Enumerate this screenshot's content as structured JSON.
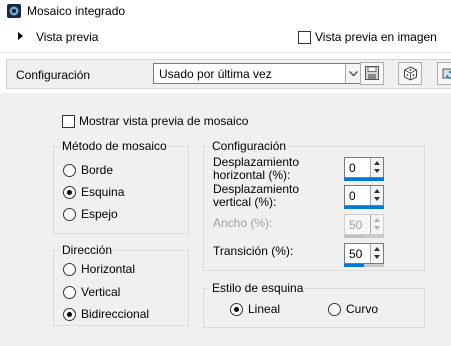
{
  "window": {
    "title": "Mosaico integrado"
  },
  "preview": {
    "toggle_label": "Vista previa",
    "image_preview_label": "Vista previa en imagen",
    "image_preview_checked": false
  },
  "config": {
    "label": "Configuración",
    "preset_value": "Usado por última vez",
    "save_icon": "save-icon",
    "randomize_icon": "dice-icon",
    "reset_icon": "reset-icon"
  },
  "mosaic_preview": {
    "label": "Mostrar vista previa de mosaico",
    "checked": false
  },
  "method": {
    "title": "Método de mosaico",
    "options": [
      "Borde",
      "Esquina",
      "Espejo"
    ],
    "selected": "Esquina"
  },
  "direction": {
    "title": "Dirección",
    "options": [
      "Horizontal",
      "Vertical",
      "Bidireccional"
    ],
    "selected": "Bidireccional"
  },
  "settings": {
    "title": "Configuración",
    "horizontal_offset": {
      "label_line1": "Desplazamiento",
      "label_line2": "horizontal (%):",
      "value": "0",
      "level": 0
    },
    "vertical_offset": {
      "label_line1": "Desplazamiento",
      "label_line2": "vertical (%):",
      "value": "0",
      "level": 0
    },
    "width": {
      "label": "Ancho (%):",
      "value": "50",
      "level": 0.5,
      "disabled": true
    },
    "transition": {
      "label": "Transición (%):",
      "value": "50",
      "level": 0.5
    }
  },
  "corner_style": {
    "title": "Estilo de esquina",
    "options": [
      "Lineal",
      "Curvo"
    ],
    "selected": "Lineal"
  },
  "colors": {
    "accent": "#0078d7",
    "panel_bg": "#f0f0f0"
  }
}
